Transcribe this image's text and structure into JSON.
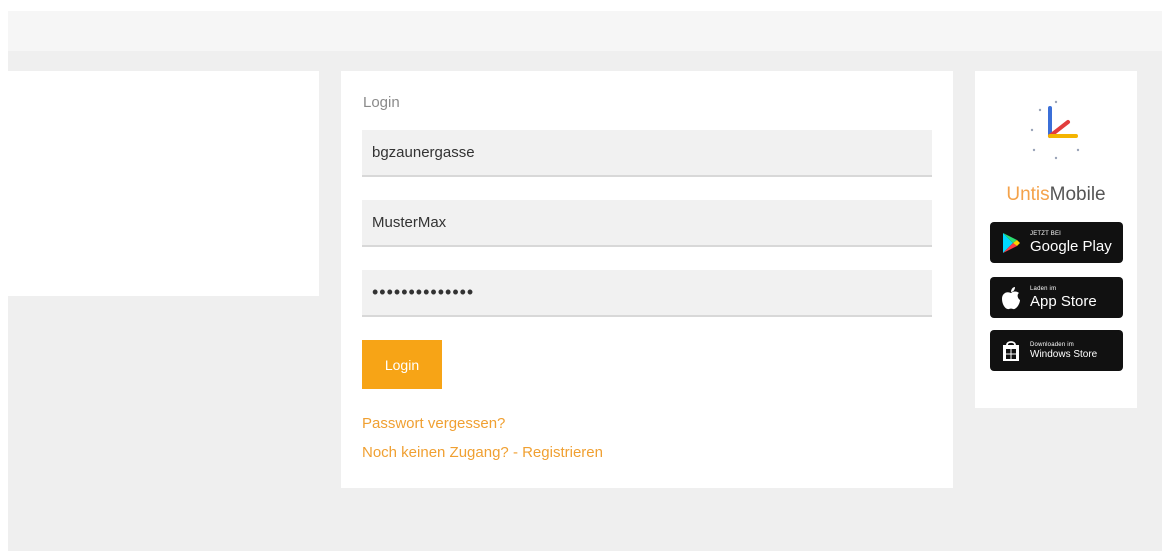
{
  "login": {
    "title": "Login",
    "school_value": "bgzaunergasse",
    "username_value": "MusterMax",
    "password_value": "••••••••••••••",
    "submit_label": "Login",
    "forgot_link": "Passwort vergessen?",
    "register_link": "Noch keinen Zugang? - Registrieren"
  },
  "side": {
    "brand_untis": "Untis",
    "brand_mobile": "Mobile",
    "badges": [
      {
        "small": "JETZT BEI",
        "big": "Google Play",
        "icon": "google-play-icon"
      },
      {
        "small": "Laden im",
        "big": "App Store",
        "icon": "apple-icon"
      },
      {
        "small": "Downloaden im",
        "big": "Windows Store",
        "icon": "windows-store-icon"
      }
    ]
  },
  "colors": {
    "accent": "#f7a416",
    "link": "#f0a032",
    "background": "#efefef",
    "badge": "#111111"
  }
}
